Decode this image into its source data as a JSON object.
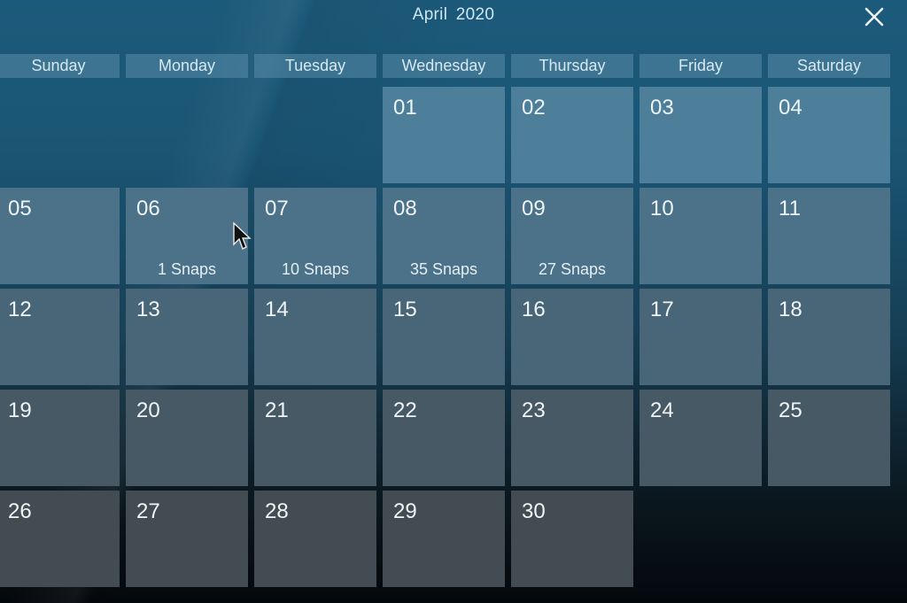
{
  "header": {
    "title": "April 2020",
    "close_icon": "close-icon"
  },
  "weekdays": [
    "Sunday",
    "Monday",
    "Tuesday",
    "Wednesday",
    "Thursday",
    "Friday",
    "Saturday"
  ],
  "calendar": {
    "month": "April",
    "year": 2020,
    "first_weekday_index": 3,
    "days": [
      {
        "label": "01",
        "snaps": ""
      },
      {
        "label": "02",
        "snaps": ""
      },
      {
        "label": "03",
        "snaps": ""
      },
      {
        "label": "04",
        "snaps": ""
      },
      {
        "label": "05",
        "snaps": ""
      },
      {
        "label": "06",
        "snaps": "1 Snaps"
      },
      {
        "label": "07",
        "snaps": "10 Snaps"
      },
      {
        "label": "08",
        "snaps": "35 Snaps"
      },
      {
        "label": "09",
        "snaps": "27 Snaps"
      },
      {
        "label": "10",
        "snaps": ""
      },
      {
        "label": "11",
        "snaps": ""
      },
      {
        "label": "12",
        "snaps": ""
      },
      {
        "label": "13",
        "snaps": ""
      },
      {
        "label": "14",
        "snaps": ""
      },
      {
        "label": "15",
        "snaps": ""
      },
      {
        "label": "16",
        "snaps": ""
      },
      {
        "label": "17",
        "snaps": ""
      },
      {
        "label": "18",
        "snaps": ""
      },
      {
        "label": "19",
        "snaps": ""
      },
      {
        "label": "20",
        "snaps": ""
      },
      {
        "label": "21",
        "snaps": ""
      },
      {
        "label": "22",
        "snaps": ""
      },
      {
        "label": "23",
        "snaps": ""
      },
      {
        "label": "24",
        "snaps": ""
      },
      {
        "label": "25",
        "snaps": ""
      },
      {
        "label": "26",
        "snaps": ""
      },
      {
        "label": "27",
        "snaps": ""
      },
      {
        "label": "28",
        "snaps": ""
      },
      {
        "label": "29",
        "snaps": ""
      },
      {
        "label": "30",
        "snaps": ""
      }
    ]
  },
  "colors": {
    "cell_top": "#4d7f9b",
    "cell_bottom": "#434c52",
    "text": "#eef4f7"
  }
}
